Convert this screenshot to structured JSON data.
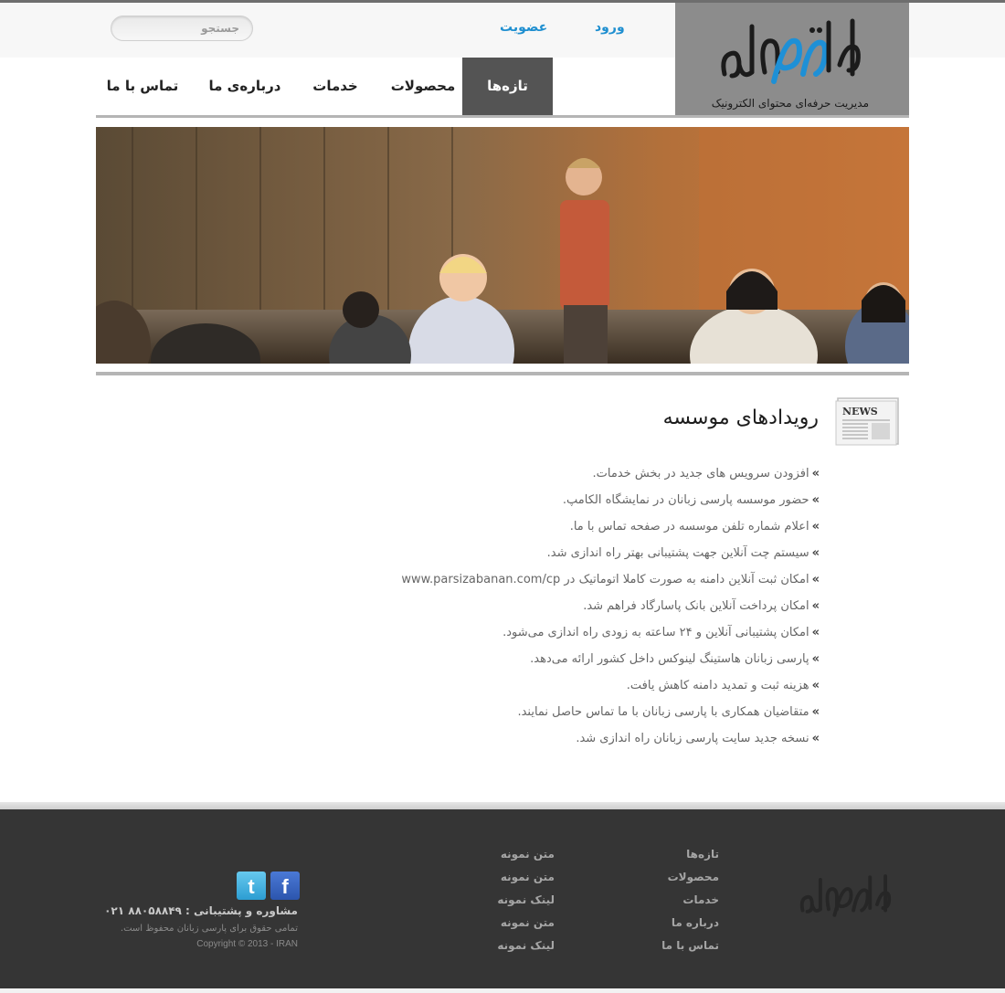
{
  "header": {
    "logo_tagline": "مدیریت حرفه‌ای محتوای الکترونیک",
    "login_label": "ورود",
    "signup_label": "عضویت",
    "search_placeholder": "جستجو"
  },
  "nav": {
    "items": [
      {
        "label": "تازه‌ها",
        "active": true
      },
      {
        "label": "محصولات",
        "active": false
      },
      {
        "label": "خدمات",
        "active": false
      },
      {
        "label": "درباره‌ی ما",
        "active": false
      },
      {
        "label": "تماس با ما",
        "active": false
      }
    ]
  },
  "news": {
    "title": "رویدادهای موسسه",
    "icon": "newspaper-icon",
    "bullet": "»",
    "items": [
      "افزودن سرویس های جدید در بخش خدمات.",
      "حضور موسسه پارسی زبانان در نمایشگاه الکامپ.",
      "اعلام شماره تلفن موسسه در صفحه تماس با ما.",
      "سیستم چت آنلاین جهت پشتیبانی بهتر راه اندازی شد.",
      "امکان ثبت آنلاین دامنه به صورت کاملا اتوماتیک در www.parsizabanan.com/cp",
      "امکان پرداخت آنلاین بانک پاسارگاد فراهم شد.",
      "امکان پشتیبانی آنلاین و ۲۴ ساعته به زودی راه اندازی می‌شود.",
      "پارسی زبانان هاستینگ لینوکس داخل کشور ارائه می‌دهد.",
      "هزینه ثبت و تمدید دامنه کاهش یافت.",
      "متقاضیان همکاری با پارسی زبانان با ما تماس حاصل نمایند.",
      "نسخه جدید سایت پارسی زبانان راه اندازی شد."
    ]
  },
  "footer": {
    "col1": [
      "تازه‌ها",
      "محصولات",
      "خدمات",
      "درباره ما",
      "تماس با ما"
    ],
    "col2": [
      "متن نمونه",
      "متن نمونه",
      "لینک نمونه",
      "متن نمونه",
      "لینک نمونه"
    ],
    "support": "مشاوره و پشتیبانی : ۸۸۰۵۸۸۴۹ ۰۲۱",
    "rights": "تمامی حقوق برای پارسی زبانان محفوظ است.",
    "copyright": "Copyright © 2013 - IRAN",
    "social": {
      "facebook": "f",
      "twitter": "t"
    }
  },
  "colors": {
    "accent": "#1f8fd0",
    "nav_active": "#545454",
    "logo_bg": "#8c8c8c",
    "footer_bg": "#353535"
  }
}
